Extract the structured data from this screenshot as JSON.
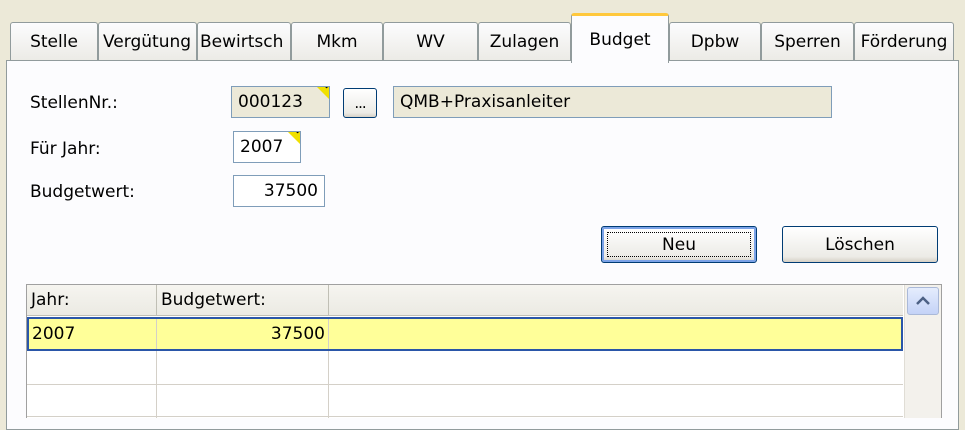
{
  "tabs": [
    {
      "label": "Stelle",
      "active": false
    },
    {
      "label": "Vergütung",
      "active": false
    },
    {
      "label": "Bewirtsch",
      "active": false
    },
    {
      "label": "Mkm",
      "active": false
    },
    {
      "label": "WV",
      "active": false
    },
    {
      "label": "Zulagen",
      "active": false
    },
    {
      "label": "Budget",
      "active": true
    },
    {
      "label": "Dpbw",
      "active": false
    },
    {
      "label": "Sperren",
      "active": false
    },
    {
      "label": "Förderung",
      "active": false
    }
  ],
  "form": {
    "stellennr_label": "StellenNr.:",
    "stellennr_value": "000123",
    "lookup_button": "...",
    "stellen_name": "QMB+Praxisanleiter",
    "jahr_label": "Für Jahr:",
    "jahr_value": "2007",
    "budget_label": "Budgetwert:",
    "budget_value": "37500"
  },
  "buttons": {
    "neu": "Neu",
    "loeschen": "Löschen"
  },
  "grid": {
    "columns": [
      "Jahr:",
      "Budgetwert:"
    ],
    "rows": [
      {
        "jahr": "2007",
        "budgetwert": "37500"
      }
    ]
  },
  "icons": {
    "scroll_up": "chevron-up-icon"
  },
  "colors": {
    "selected_row": "#ffff99",
    "active_tab_accent": "#ffc83c"
  }
}
